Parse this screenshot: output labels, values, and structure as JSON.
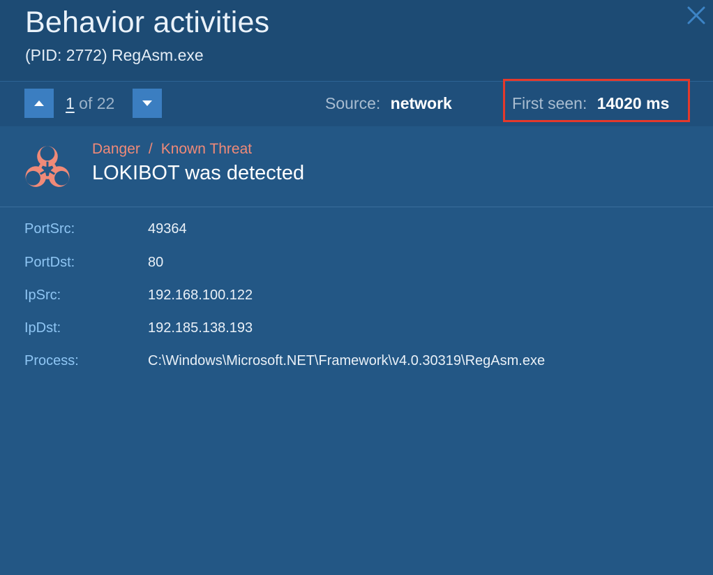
{
  "window": {
    "title": "Behavior activities",
    "subtitle": "(PID: 2772) RegAsm.exe",
    "close_icon": "close-icon"
  },
  "toolbar": {
    "prev_icon": "chevron-up-icon",
    "next_icon": "chevron-down-icon",
    "page_current": "1",
    "page_of": " of ",
    "page_total": "22",
    "source_label": "Source:",
    "source_value": "network",
    "first_seen_label": "First seen:",
    "first_seen_value": "14020 ms",
    "highlight_color": "#e5392b"
  },
  "threat": {
    "icon": "biohazard-icon",
    "level": "Danger",
    "separator": "/",
    "category": "Known Threat",
    "title": "LOKIBOT was detected",
    "accent_color": "#f08a78"
  },
  "details": [
    {
      "key": "PortSrc:",
      "value": "49364"
    },
    {
      "key": "PortDst:",
      "value": "80"
    },
    {
      "key": "IpSrc:",
      "value": "192.168.100.122"
    },
    {
      "key": "IpDst:",
      "value": "192.185.138.193"
    },
    {
      "key": "Process:",
      "value": "C:\\Windows\\Microsoft.NET\\Framework\\v4.0.30319\\RegAsm.exe"
    }
  ]
}
